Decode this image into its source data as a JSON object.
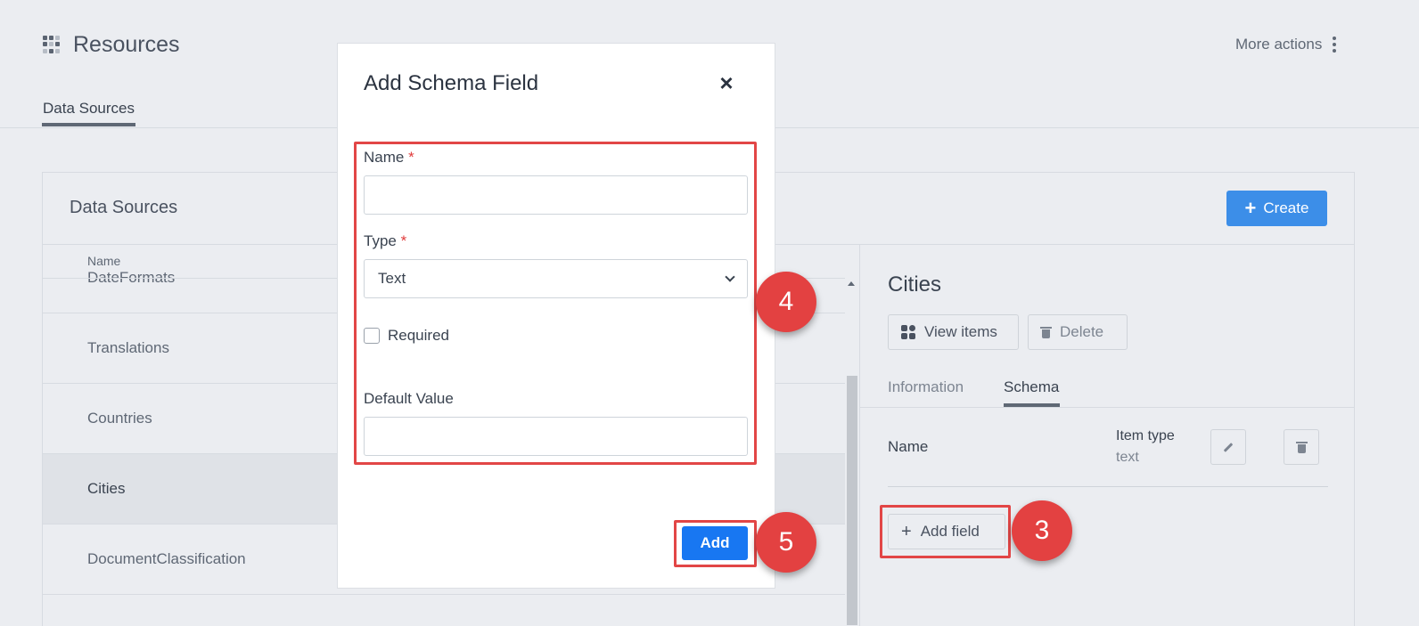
{
  "header": {
    "app_title": "Resources",
    "more_actions": "More actions",
    "tab": "Data Sources"
  },
  "panel": {
    "title": "Data Sources",
    "create_label": "Create"
  },
  "list": {
    "column_header": "Name",
    "partial_row": "DateFormats",
    "rows": [
      {
        "label": "Translations",
        "selected": false
      },
      {
        "label": "Countries",
        "selected": false
      },
      {
        "label": "Cities",
        "selected": true
      },
      {
        "label": "DocumentClassification",
        "selected": false
      }
    ]
  },
  "detail": {
    "title": "Cities",
    "view_items_label": "View items",
    "delete_label": "Delete",
    "tabs": [
      {
        "label": "Information",
        "active": false
      },
      {
        "label": "Schema",
        "active": true
      }
    ],
    "schema_field": {
      "name": "Name",
      "item_type_label": "Item type",
      "item_type_value": "text"
    },
    "add_field_label": "Add field"
  },
  "modal": {
    "title": "Add Schema Field",
    "name_label": "Name",
    "name_value": "",
    "type_label": "Type",
    "type_value": "Text",
    "required_label": "Required",
    "required_checked": false,
    "default_label": "Default Value",
    "default_value": "",
    "required_marker": "*",
    "add_label": "Add"
  },
  "annotations": {
    "step_form": "4",
    "step_add": "5",
    "step_add_field": "3",
    "color": "#e34141"
  },
  "colors": {
    "primary": "#1877f2",
    "create": "#3c8ee8"
  }
}
